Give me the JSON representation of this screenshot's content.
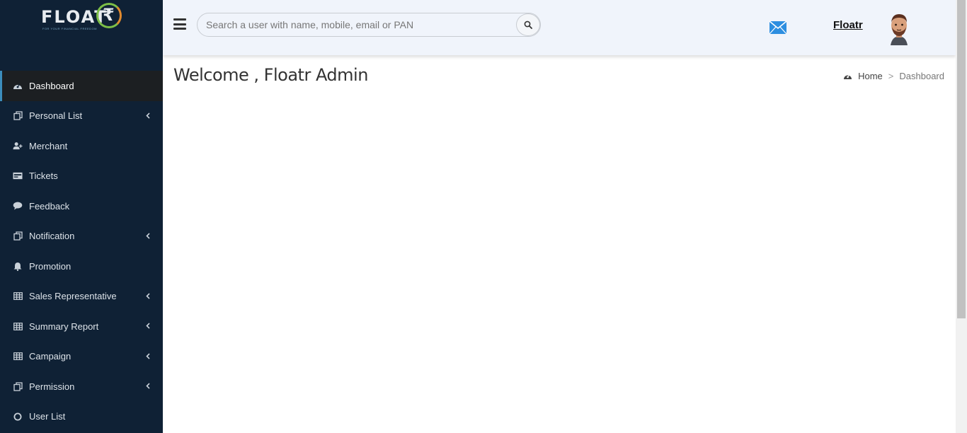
{
  "logo": {
    "text": "FLOAT",
    "rupee": "₹",
    "tagline": "FOR YOUR FINANCIAL FREEDOM"
  },
  "sidebar": {
    "items": [
      {
        "label": "Dashboard",
        "icon": "dashboard-icon",
        "active": true,
        "has_submenu": false
      },
      {
        "label": "Personal List",
        "icon": "copy-icon",
        "active": false,
        "has_submenu": true
      },
      {
        "label": "Merchant",
        "icon": "user-plus-icon",
        "active": false,
        "has_submenu": false
      },
      {
        "label": "Tickets",
        "icon": "ticket-icon",
        "active": false,
        "has_submenu": false
      },
      {
        "label": "Feedback",
        "icon": "comment-icon",
        "active": false,
        "has_submenu": false
      },
      {
        "label": "Notification",
        "icon": "copy-icon",
        "active": false,
        "has_submenu": true
      },
      {
        "label": "Promotion",
        "icon": "bell-icon",
        "active": false,
        "has_submenu": false
      },
      {
        "label": "Sales Representative",
        "icon": "table-icon",
        "active": false,
        "has_submenu": true
      },
      {
        "label": "Summary Report",
        "icon": "table-icon",
        "active": false,
        "has_submenu": true
      },
      {
        "label": "Campaign",
        "icon": "table-icon",
        "active": false,
        "has_submenu": true
      },
      {
        "label": "Permission",
        "icon": "copy-icon",
        "active": false,
        "has_submenu": true
      },
      {
        "label": "User List",
        "icon": "circle-icon",
        "active": false,
        "has_submenu": false
      }
    ]
  },
  "header": {
    "search_placeholder": "Search a user with name, mobile, email or PAN",
    "search_value": "",
    "user_name": "Floatr "
  },
  "main": {
    "title": "Welcome , Floatr Admin",
    "breadcrumb": {
      "home": "Home",
      "separator": ">",
      "current": "Dashboard"
    }
  },
  "colors": {
    "sidebar_bg": "#0f2135",
    "active_bg": "#1c1f22",
    "active_accent": "#3c8dbc",
    "header_bg": "#f0f4fb",
    "mail_blue": "#2d8ee0"
  }
}
